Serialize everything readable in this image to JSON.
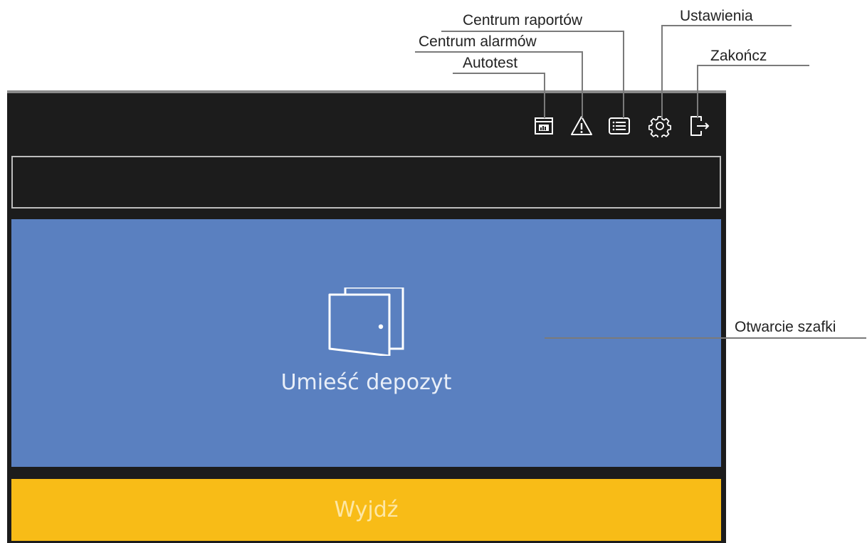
{
  "callouts": {
    "report_center": "Centrum raportów",
    "alarm_center": "Centrum alarmów",
    "autotest": "Autotest",
    "settings": "Ustawienia",
    "exit_app": "Zakończ",
    "open_locker": "Otwarcie szafki"
  },
  "toolbar": {
    "icons": [
      "autotest-icon",
      "alarm-icon",
      "report-list-icon",
      "settings-gear-icon",
      "exit-door-icon"
    ]
  },
  "status": {
    "text": ""
  },
  "main": {
    "deposit_label": "Umieść depozyt",
    "exit_label": "Wyjdź"
  },
  "colors": {
    "screen_bg": "#1c1c1c",
    "deposit_bg": "#5a80c0",
    "exit_bg": "#f8bc17",
    "icon": "#ffffff"
  }
}
